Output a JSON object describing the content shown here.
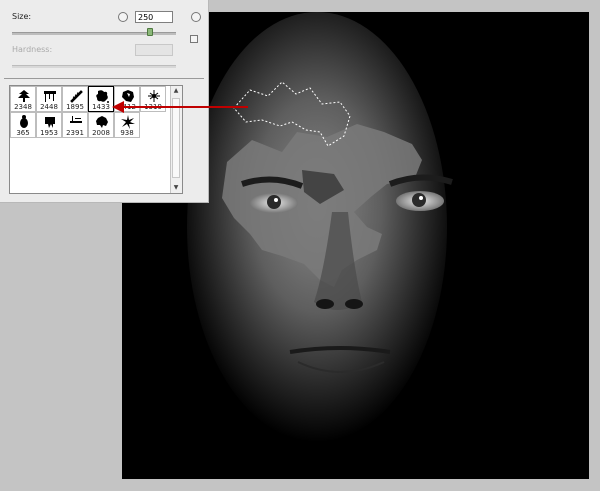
{
  "brush_panel": {
    "size_label": "Size:",
    "size_value": "250",
    "hardness_label": "Hardness:",
    "size_slider_level": 0.84,
    "brushes": [
      {
        "size": "2348",
        "icon": "tree-brush-icon"
      },
      {
        "size": "2448",
        "icon": "drip-brush-icon"
      },
      {
        "size": "1895",
        "icon": "feather-brush-icon"
      },
      {
        "size": "1433",
        "icon": "splatter-brush-icon",
        "selected": true
      },
      {
        "size": "1412",
        "icon": "ink-blot-brush-icon"
      },
      {
        "size": "1319",
        "icon": "spray-brush-icon"
      },
      {
        "size": "365",
        "icon": "bug-brush-icon"
      },
      {
        "size": "1953",
        "icon": "stain-brush-icon"
      },
      {
        "size": "2391",
        "icon": "text-brush-icon"
      },
      {
        "size": "2008",
        "icon": "splash-brush-icon"
      },
      {
        "size": "938",
        "icon": "burst-brush-icon"
      }
    ]
  },
  "annotation": {
    "color": "#c00000",
    "target": "1433"
  },
  "canvas": {
    "subject": "face-photo",
    "background": "#000000"
  },
  "colors": {
    "panel_bg": "#ececec",
    "workspace_bg": "#c4c4c4",
    "slider_thumb": "#8cb87a"
  }
}
